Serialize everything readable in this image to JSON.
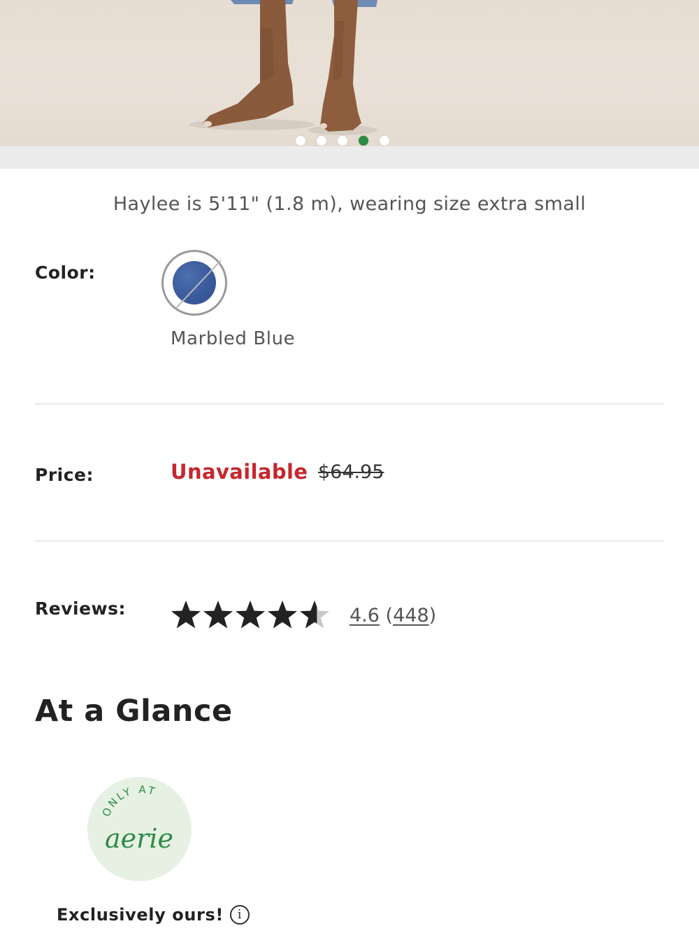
{
  "gallery": {
    "slide_count": 5,
    "active_slide": 4
  },
  "model_note": "Haylee is 5'11\" (1.8 m), wearing size extra small",
  "color": {
    "label": "Color:",
    "selected_name": "Marbled Blue",
    "swatch_color": "#3a5a9c",
    "unavailable": true
  },
  "price": {
    "label": "Price:",
    "status": "Unavailable",
    "original": "$64.95",
    "status_color": "#c6262e"
  },
  "reviews": {
    "label": "Reviews:",
    "rating": "4.6",
    "rating_value": 4.6,
    "count_open": "(",
    "count": "448",
    "count_close": ")"
  },
  "at_a_glance": {
    "heading": "At a Glance",
    "badge_top": "ONLY AT",
    "badge_brand": "aerie",
    "badge_color": "#2e8b45",
    "exclusive_text": "Exclusively ours!",
    "info_icon": "info-icon"
  }
}
